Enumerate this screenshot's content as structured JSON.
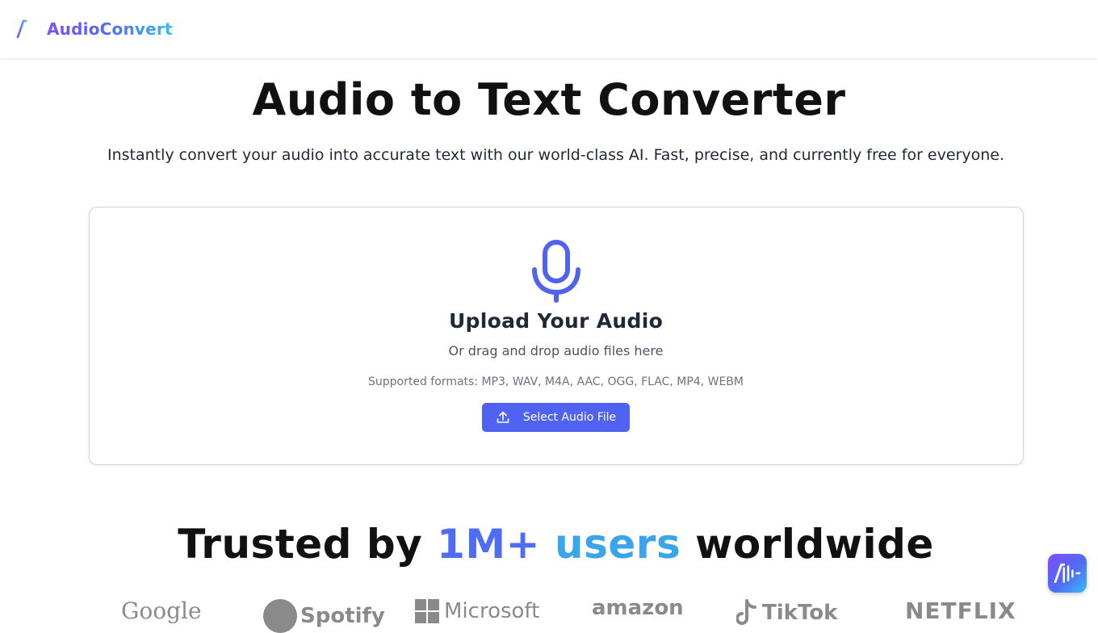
{
  "header": {
    "brand_name": "AudioConvert",
    "logo_icon": "audio-wave-logo-icon"
  },
  "hero": {
    "title": "Audio to Text Converter",
    "subtitle": "Instantly convert your audio into accurate text with our world-class AI. Fast, precise, and currently free for everyone."
  },
  "upload": {
    "icon": "microphone-icon",
    "title": "Upload Your Audio",
    "drag_text": "Or drag and drop audio files here",
    "formats_text": "Supported formats: MP3, WAV, M4A, AAC, OGG, FLAC, MP4, WEBM",
    "button_label": "Select Audio File",
    "button_icon": "upload-icon"
  },
  "trusted": {
    "prefix": "Trusted by",
    "highlight_1": "1M+",
    "highlight_2": "users",
    "suffix": "worldwide"
  },
  "logos": [
    "Google",
    "Spotify",
    "Microsoft",
    "amazon",
    "TikTok",
    "NETFLIX"
  ],
  "colors": {
    "accent": "#4f63f0",
    "brand_gradient_start": "#7c4dff",
    "brand_gradient_end": "#38bdf8",
    "highlight_blue": "#4f6cf5",
    "highlight_cyan": "#3ba5ec"
  },
  "floating_button": {
    "icon": "audio-wave-logo-icon"
  }
}
